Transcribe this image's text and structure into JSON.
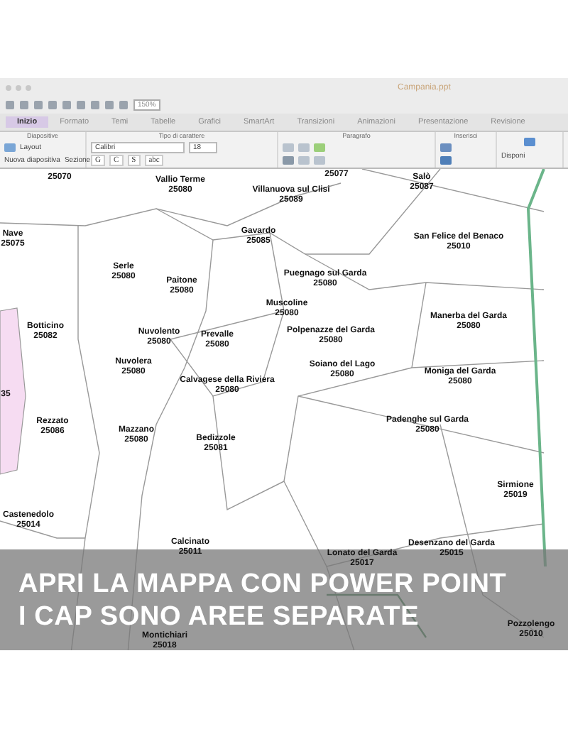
{
  "window": {
    "title": "Campania.ppt"
  },
  "quick_toolbar": {
    "zoom": "150%"
  },
  "tabs": [
    {
      "label": "Inizio",
      "selected": true
    },
    {
      "label": "Formato",
      "selected": false
    },
    {
      "label": "Temi",
      "selected": false
    },
    {
      "label": "Tabelle",
      "selected": false
    },
    {
      "label": "Grafici",
      "selected": false
    },
    {
      "label": "SmartArt",
      "selected": false
    },
    {
      "label": "Transizioni",
      "selected": false
    },
    {
      "label": "Animazioni",
      "selected": false
    },
    {
      "label": "Presentazione",
      "selected": false
    },
    {
      "label": "Revisione",
      "selected": false
    }
  ],
  "ribbon": {
    "groups": [
      "Diapositive",
      "Tipo di carattere",
      "Paragrafo",
      "Inserisci"
    ],
    "new_slide": "Nuova diapositiva",
    "layout": "Layout",
    "section": "Sezione",
    "font": "Calibri",
    "font_size": "18",
    "format_buttons": [
      "G",
      "C",
      "S",
      "abc"
    ],
    "arrange": "Disponi"
  },
  "map": {
    "labels": [
      {
        "cap": "25070"
      },
      {
        "name": "Vallio Terme",
        "cap": "25080"
      },
      {
        "name": "Villanuova sul Clisi",
        "cap": "25089"
      },
      {
        "cap": "25077"
      },
      {
        "name": "Salò",
        "cap": "25087"
      },
      {
        "name": "Nave",
        "cap": "25075"
      },
      {
        "name": "Gavardo",
        "cap": "25085"
      },
      {
        "name": "San Felice del Benaco",
        "cap": "25010"
      },
      {
        "name": "Serle",
        "cap": "25080"
      },
      {
        "name": "Paitone",
        "cap": "25080"
      },
      {
        "name": "Puegnago sul Garda",
        "cap": "25080"
      },
      {
        "name": "Muscoline",
        "cap": "25080"
      },
      {
        "name": "Manerba del Garda",
        "cap": "25080"
      },
      {
        "name": "Botticino",
        "cap": "25082"
      },
      {
        "name": "Nuvolento",
        "cap": "25080"
      },
      {
        "name": "Prevalle",
        "cap": "25080"
      },
      {
        "name": "Polpenazze del Garda",
        "cap": "25080"
      },
      {
        "name": "Nuvolera",
        "cap": "25080"
      },
      {
        "name": "Soiano del Lago",
        "cap": "25080"
      },
      {
        "name": "Moniga del Garda",
        "cap": "25080"
      },
      {
        "name": "Calvagese della Riviera",
        "cap": "25080"
      },
      {
        "cap": "35"
      },
      {
        "name": "Rezzato",
        "cap": "25086"
      },
      {
        "name": "Mazzano",
        "cap": "25080"
      },
      {
        "name": "Bedizzole",
        "cap": "25081"
      },
      {
        "name": "Padenghe sul Garda",
        "cap": "25080"
      },
      {
        "name": "Sirmione",
        "cap": "25019"
      },
      {
        "name": "Castenedolo",
        "cap": "25014"
      },
      {
        "name": "Calcinato",
        "cap": "25011"
      },
      {
        "name": "Desenzano del Garda",
        "cap": "25015"
      },
      {
        "name": "Lonato del Garda",
        "cap": "25017"
      },
      {
        "name": "Pozzolengo",
        "cap": "25010"
      },
      {
        "name": "Montichiari",
        "cap": "25018"
      }
    ]
  },
  "banner": {
    "lines": [
      "APRI LA MAPPA CON POWER POINT",
      "I CAP SONO AREE SEPARATE"
    ]
  }
}
